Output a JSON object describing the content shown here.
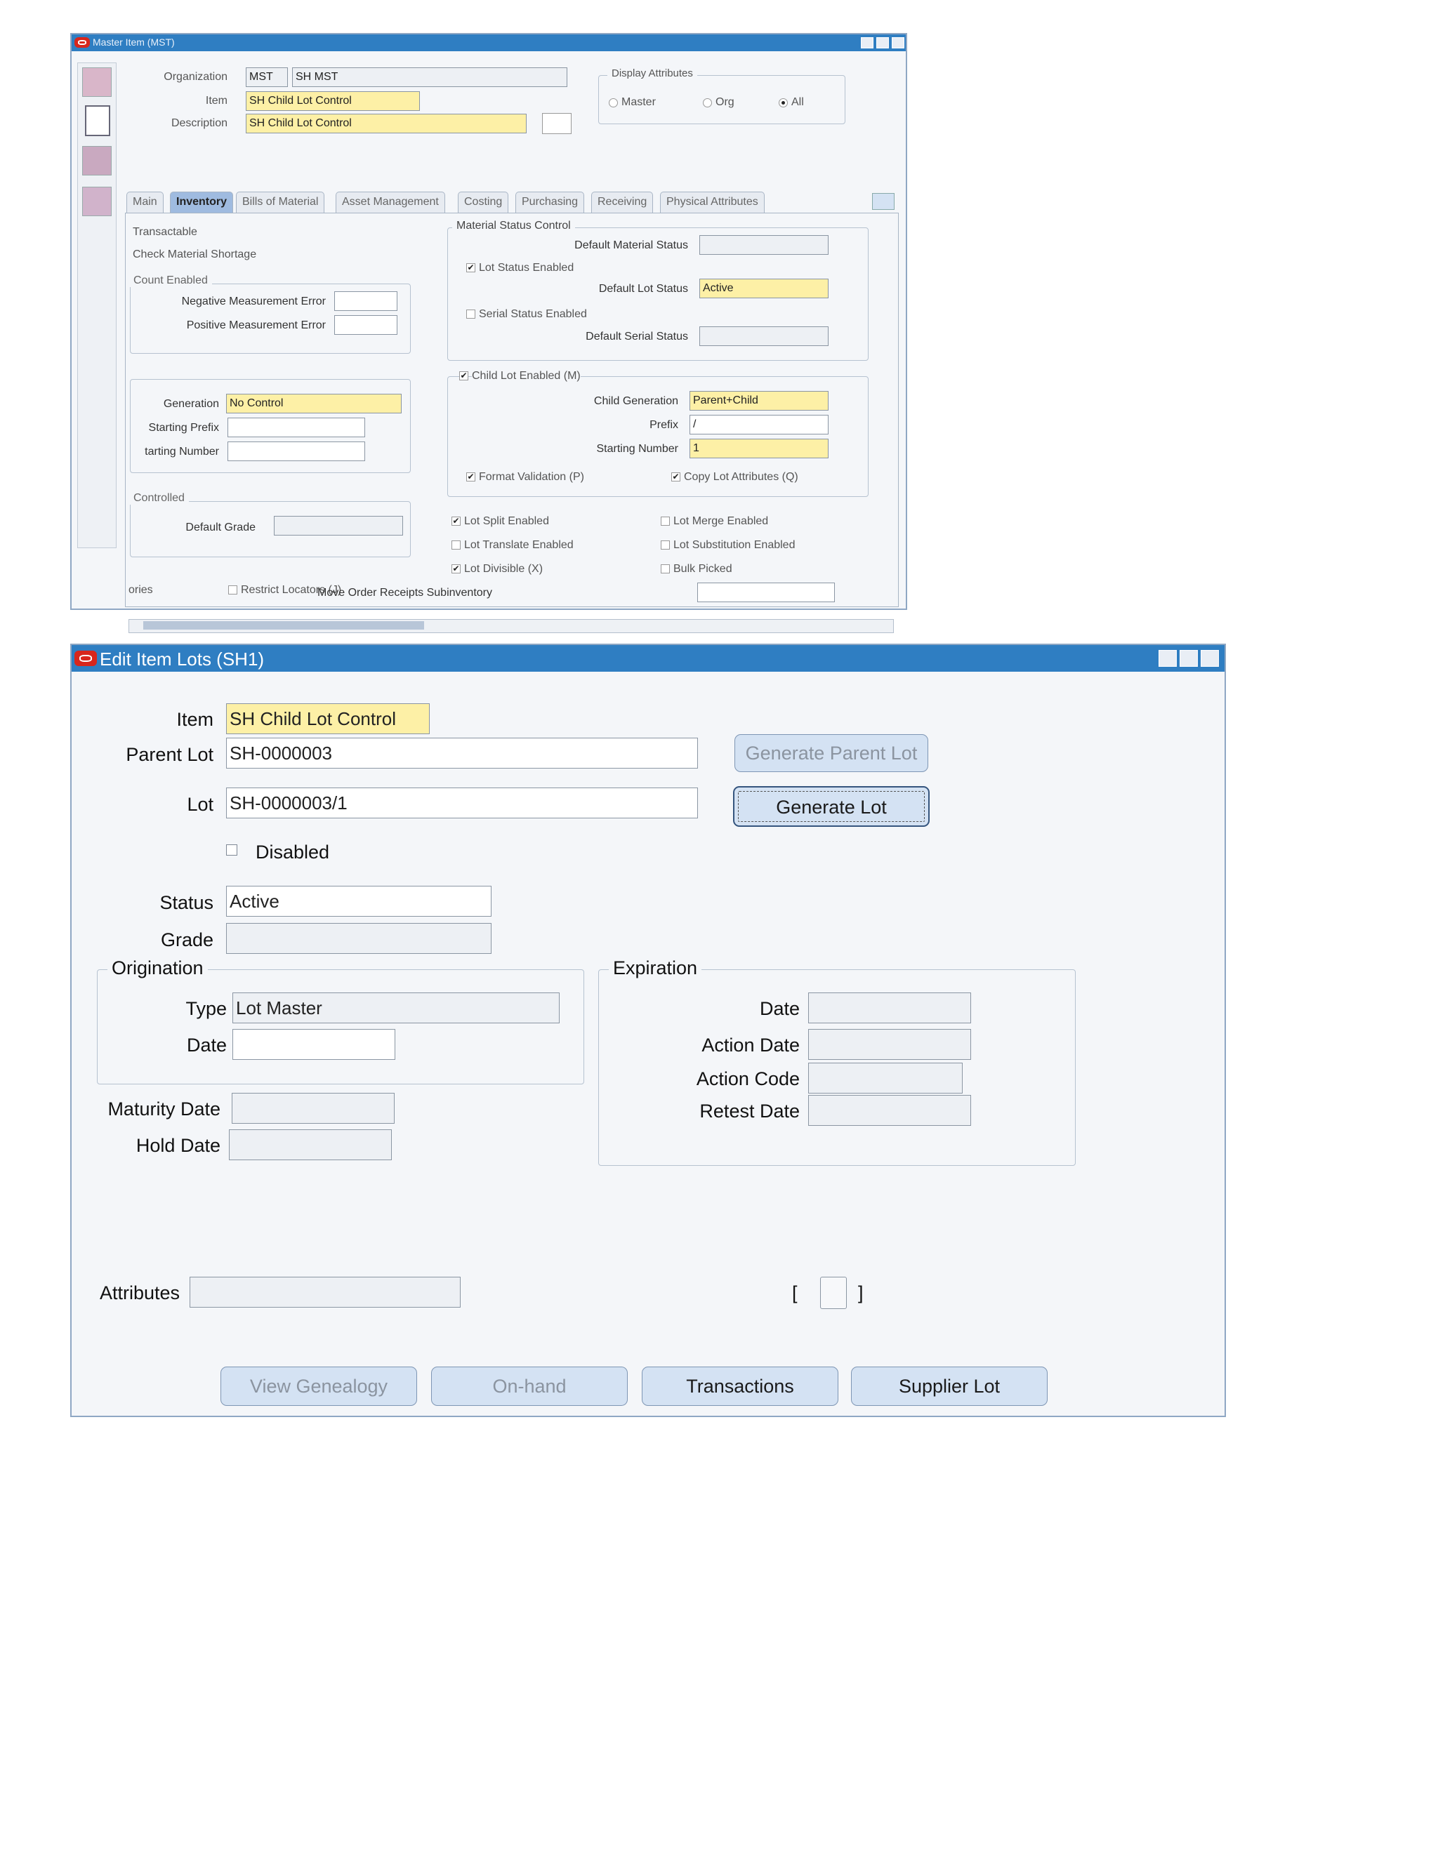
{
  "top_window": {
    "title": "Master Item (MST)",
    "header": {
      "org_label": "Organization",
      "org_code": "MST",
      "org_name": "SH MST",
      "item_label": "Item",
      "item_value": "SH Child Lot Control",
      "desc_label": "Description",
      "desc_value": "SH Child Lot Control",
      "display_group": "Display Attributes",
      "radio_master": "Master",
      "radio_org": "Org",
      "radio_all": "All"
    },
    "tabs": [
      "Main",
      "Inventory",
      "Bills of Material",
      "Asset Management",
      "Costing",
      "Purchasing",
      "Receiving",
      "Physical Attributes"
    ],
    "left": {
      "transactable": "Transactable",
      "check_shortage": "Check Material Shortage",
      "count_enabled": "Count Enabled",
      "neg_err": "Negative Measurement Error",
      "pos_err": "Positive Measurement Error",
      "generation_label": "Generation",
      "generation_value": "No Control",
      "starting_prefix": "Starting Prefix",
      "starting_number": "tarting Number",
      "controlled": "Controlled",
      "default_grade": "Default Grade",
      "ories": "ories",
      "restrict_locators": "Restrict Locators (J)"
    },
    "right": {
      "msc_group": "Material Status Control",
      "default_material_status": "Default Material Status",
      "lot_status_enabled": "Lot Status Enabled",
      "default_lot_status": "Default Lot Status",
      "default_lot_status_value": "Active",
      "serial_status_enabled": "Serial Status Enabled",
      "default_serial_status": "Default Serial Status",
      "child_lot_enabled": "Child Lot Enabled (M)",
      "child_generation": "Child Generation",
      "child_generation_value": "Parent+Child",
      "prefix": "Prefix",
      "prefix_value": "/",
      "starting_number": "Starting Number",
      "starting_number_value": "1",
      "format_validation": "Format Validation (P)",
      "copy_lot_attributes": "Copy Lot Attributes (Q)",
      "lot_split": "Lot Split Enabled",
      "lot_merge": "Lot Merge Enabled",
      "lot_translate": "Lot Translate Enabled",
      "lot_substitution": "Lot Substitution Enabled",
      "lot_divisible": "Lot Divisible (X)",
      "bulk_picked": "Bulk Picked",
      "move_order": "Move Order Receipts Subinventory"
    }
  },
  "edit_window": {
    "title": "Edit Item Lots (SH1)",
    "item_label": "Item",
    "item_value": "SH Child Lot Control",
    "parent_lot_label": "Parent Lot",
    "parent_lot_value": "SH-0000003",
    "lot_label": "Lot",
    "lot_value": "SH-0000003/1",
    "generate_parent_lot": "Generate Parent Lot",
    "generate_lot": "Generate Lot",
    "disabled_label": "Disabled",
    "status_label": "Status",
    "status_value": "Active",
    "grade_label": "Grade",
    "origination": {
      "title": "Origination",
      "type_label": "Type",
      "type_value": "Lot Master",
      "date_label": "Date"
    },
    "expiration": {
      "title": "Expiration",
      "date_label": "Date",
      "action_date_label": "Action Date",
      "action_code_label": "Action Code",
      "retest_date_label": "Retest Date"
    },
    "maturity_date_label": "Maturity Date",
    "hold_date_label": "Hold Date",
    "attributes_label": "Attributes",
    "bracket_left": "[",
    "bracket_right": "]",
    "buttons": {
      "view_genealogy": "View Genealogy",
      "on_hand": "On-hand",
      "transactions": "Transactions",
      "supplier_lot": "Supplier Lot"
    }
  }
}
